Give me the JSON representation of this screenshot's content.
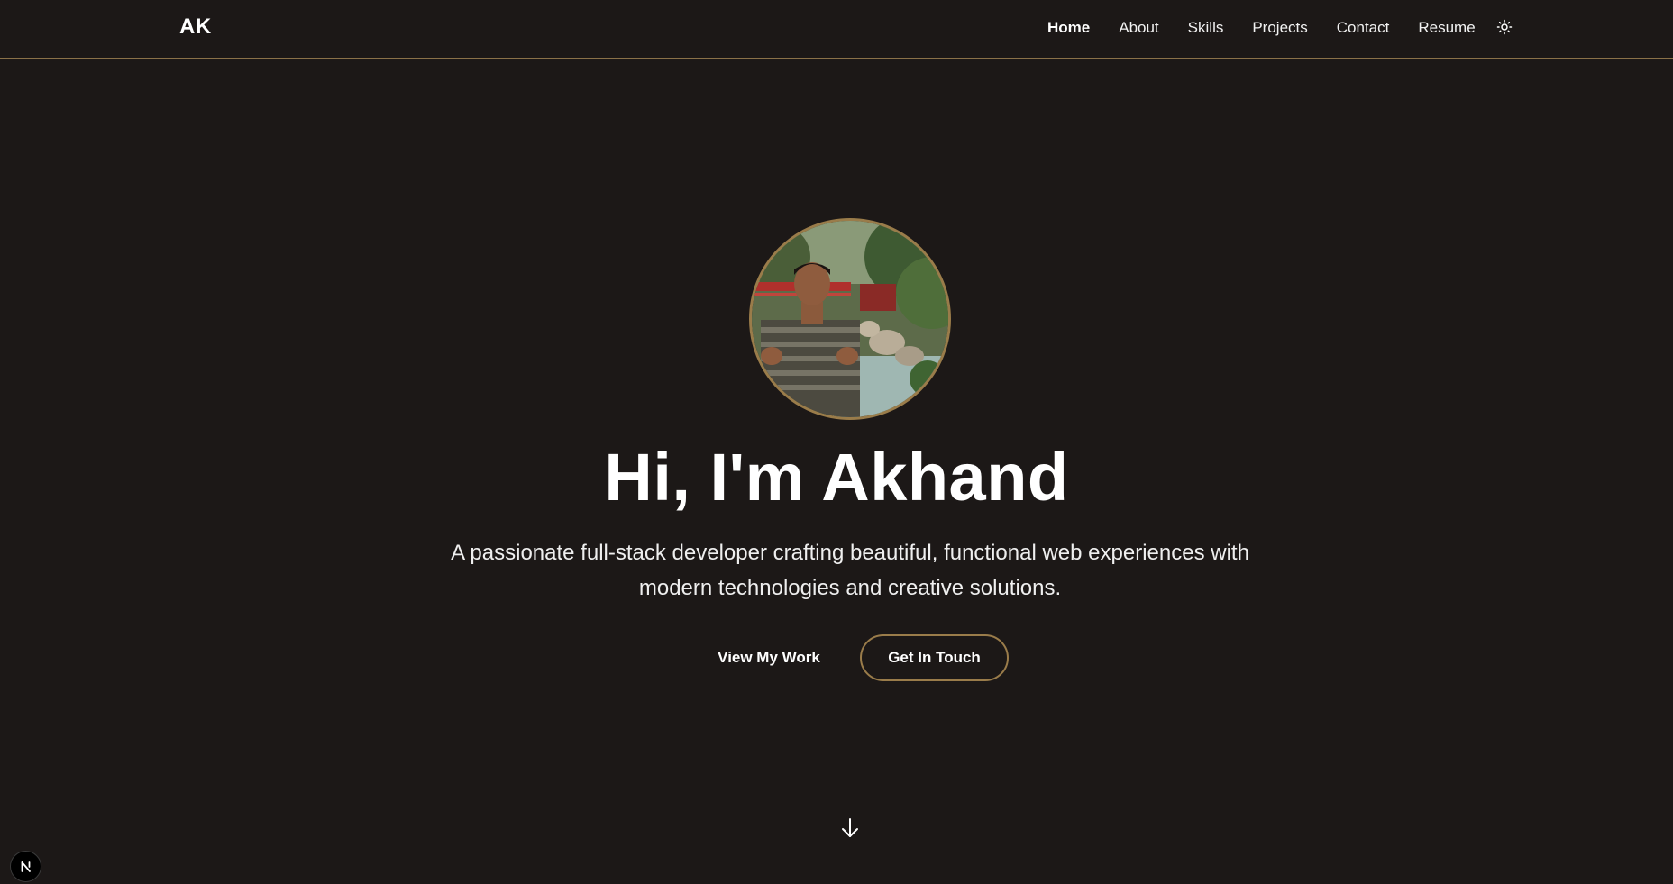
{
  "header": {
    "logo": "AK",
    "nav": [
      {
        "label": "Home",
        "active": true
      },
      {
        "label": "About",
        "active": false
      },
      {
        "label": "Skills",
        "active": false
      },
      {
        "label": "Projects",
        "active": false
      },
      {
        "label": "Contact",
        "active": false
      },
      {
        "label": "Resume",
        "active": false
      }
    ],
    "theme_toggle_icon": "sun-icon"
  },
  "hero": {
    "avatar_icon": "profile-photo",
    "title": "Hi, I'm Akhand",
    "subtitle": "A passionate full-stack developer crafting beautiful, functional web experiences with modern technologies and creative solutions.",
    "primary_button": "View My Work",
    "secondary_button": "Get In Touch",
    "scroll_icon": "arrow-down-icon"
  },
  "dev_badge": {
    "icon": "nextjs-icon",
    "letter": "N"
  },
  "colors": {
    "background": "#1c1817",
    "accent": "#9a7c4a",
    "text": "#ffffff"
  }
}
